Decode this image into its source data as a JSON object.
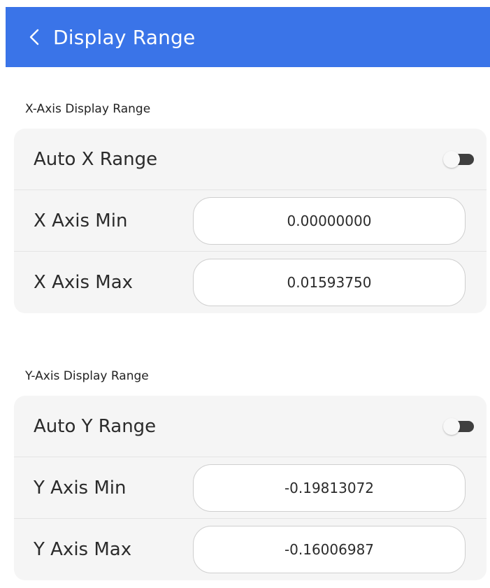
{
  "header": {
    "title": "Display Range",
    "back_icon": "chevron-left-icon"
  },
  "x_section": {
    "title": "X-Axis Display Range",
    "auto_label": "Auto X Range",
    "auto_enabled": false,
    "min_label": "X Axis Min",
    "min_value": "0.00000000",
    "max_label": "X Axis Max",
    "max_value": "0.01593750"
  },
  "y_section": {
    "title": "Y-Axis Display Range",
    "auto_label": "Auto Y Range",
    "auto_enabled": false,
    "min_label": "Y Axis Min",
    "min_value": "-0.19813072",
    "max_label": "Y Axis Max",
    "max_value": "-0.16006987"
  },
  "colors": {
    "header_bg": "#3a74e8",
    "card_bg": "#f5f5f5",
    "toggle_track": "#3f3f3f",
    "toggle_knob": "#f8f8f8"
  }
}
